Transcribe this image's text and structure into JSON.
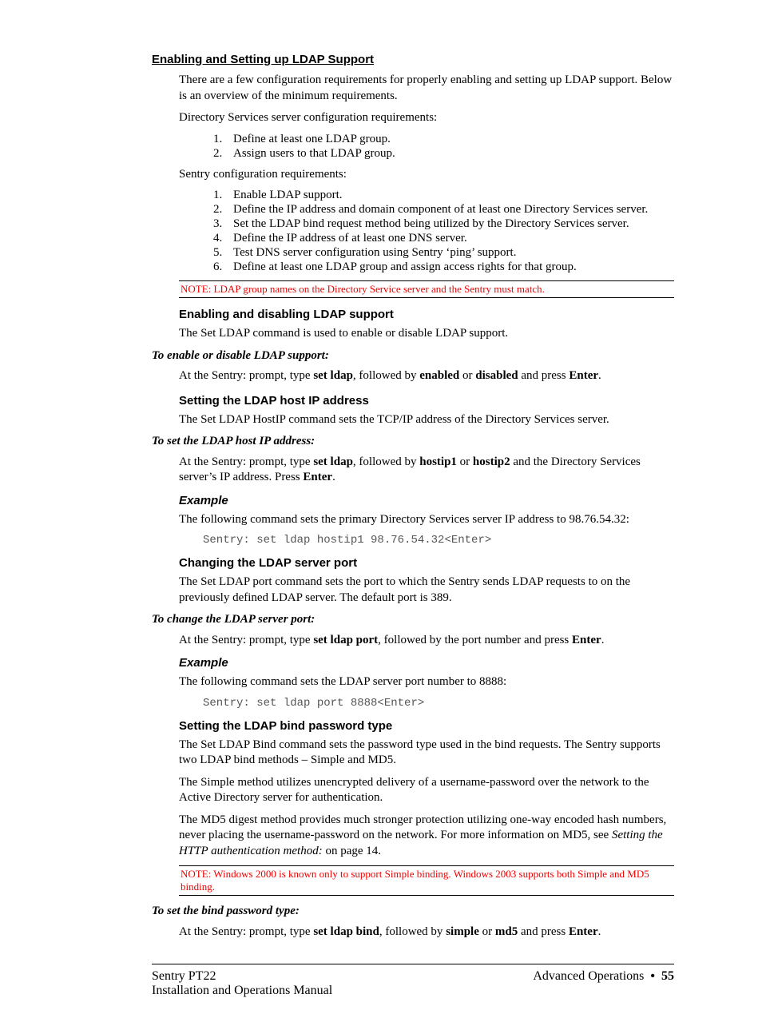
{
  "h_main": "Enabling and Setting up LDAP Support",
  "intro_p": "There are a few configuration requirements for properly enabling and setting up LDAP support.  Below is an overview of the minimum requirements.",
  "ds_req_label": "Directory Services server configuration requirements:",
  "ds_req_items": [
    "Define at least one LDAP group.",
    "Assign users to that LDAP group."
  ],
  "sentry_req_label": "Sentry configuration requirements:",
  "sentry_req_items": [
    "Enable LDAP support.",
    "Define the IP address and domain component of at least one Directory Services server.",
    "Set the LDAP bind request method being utilized by the Directory Services server.",
    "Define the IP address of at least one DNS server.",
    "Test DNS server configuration using Sentry ‘ping’ support.",
    "Define at least one LDAP group and assign access rights for that group."
  ],
  "note1": "NOTE:  LDAP group names on the Directory Service server and the Sentry must match.",
  "sec1_h": "Enabling and disabling LDAP support",
  "sec1_p": "The Set LDAP command is used to enable or disable LDAP support.",
  "sec1_sub": "To enable or disable LDAP support:",
  "sec1_cmd_pre": "At the Sentry: prompt, type ",
  "sec1_cmd_b1": "set ldap",
  "sec1_cmd_mid1": ", followed by ",
  "sec1_cmd_b2": "enabled",
  "sec1_cmd_mid2": " or ",
  "sec1_cmd_b3": "disabled",
  "sec1_cmd_mid3": " and press ",
  "sec1_cmd_b4": "Enter",
  "sec1_cmd_end": ".",
  "sec2_h": "Setting the LDAP host IP address",
  "sec2_p": "The Set LDAP HostIP command sets the TCP/IP address of the Directory Services server.",
  "sec2_sub": "To set the LDAP host IP address:",
  "sec2_cmd_pre": "At the Sentry: prompt, type ",
  "sec2_cmd_b1": "set ldap",
  "sec2_cmd_mid1": ", followed by ",
  "sec2_cmd_b2": "hostip1",
  "sec2_cmd_mid2": " or ",
  "sec2_cmd_b3": "hostip2",
  "sec2_cmd_mid3": " and the Directory Services server’s IP address.  Press ",
  "sec2_cmd_b4": "Enter",
  "sec2_cmd_end": ".",
  "ex1_h": "Example",
  "ex1_p": "The following command sets the primary Directory Services server IP address to 98.76.54.32:",
  "ex1_code": "Sentry: set ldap hostip1 98.76.54.32<Enter>",
  "sec3_h": "Changing the LDAP server port",
  "sec3_p": "The Set LDAP port command sets the port to which the Sentry sends LDAP requests to on the previously defined LDAP server.  The default port is 389.",
  "sec3_sub": "To change the LDAP server port:",
  "sec3_cmd_pre": "At the Sentry: prompt, type ",
  "sec3_cmd_b1": "set ldap port",
  "sec3_cmd_mid1": ", followed by the port number and press ",
  "sec3_cmd_b2": "Enter",
  "sec3_cmd_end": ".",
  "ex2_h": "Example",
  "ex2_p": "The following command sets the LDAP server port number to 8888:",
  "ex2_code": "Sentry: set ldap port 8888<Enter>",
  "sec4_h": "Setting the LDAP bind password type",
  "sec4_p1": "The Set LDAP Bind command sets the password type used in the bind requests.  The Sentry supports two LDAP bind methods – Simple and MD5.",
  "sec4_p2": "The Simple method utilizes unencrypted delivery of a username-password over the network to the Active Directory server for authentication.",
  "sec4_p3a": "The MD5 digest method provides much stronger protection utilizing one-way encoded hash numbers, never placing the username-password on the network.  For more information on MD5, see ",
  "sec4_p3i": "Setting the HTTP authentication method:",
  "sec4_p3b": " on page 14.",
  "note2": "NOTE:  Windows 2000 is known only to support Simple binding.  Windows 2003 supports both Simple and MD5 binding.",
  "sec4_sub": "To set the bind password type:",
  "sec4_cmd_pre": "At the Sentry: prompt, type ",
  "sec4_cmd_b1": "set ldap bind",
  "sec4_cmd_mid1": ", followed by ",
  "sec4_cmd_b2": "simple",
  "sec4_cmd_mid2": " or ",
  "sec4_cmd_b3": "md5",
  "sec4_cmd_mid3": " and press ",
  "sec4_cmd_b4": "Enter",
  "sec4_cmd_end": ".",
  "footer_left1": "Sentry PT22",
  "footer_left2": "Installation and Operations Manual",
  "footer_right1": "Advanced Operations  ",
  "footer_page": "55"
}
